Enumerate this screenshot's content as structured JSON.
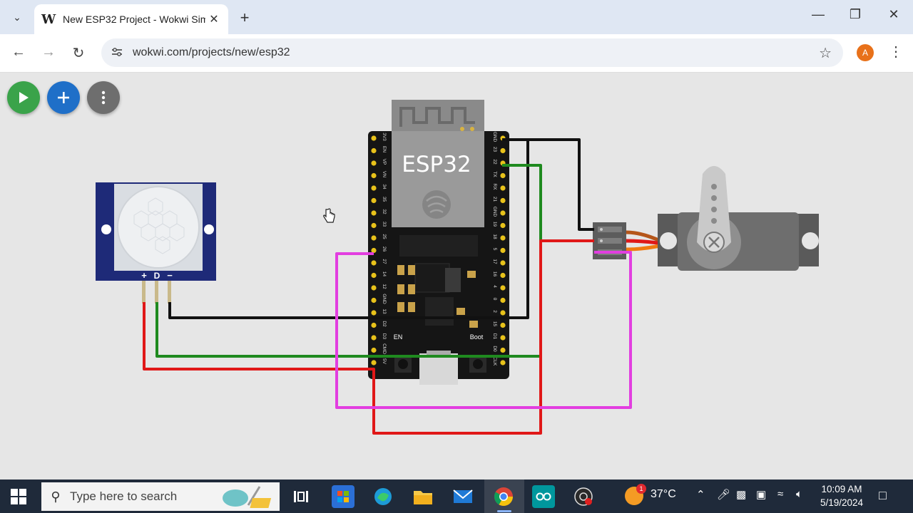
{
  "browser": {
    "tab": {
      "title": "New ESP32 Project - Wokwi Sim",
      "favicon": "W",
      "close": "✕"
    },
    "new_tab": "+",
    "window": {
      "minimize": "—",
      "restore": "❐",
      "close": "✕"
    },
    "nav": {
      "back": "←",
      "forward": "→",
      "reload": "↻"
    },
    "url": "wokwi.com/projects/new/esp32",
    "profile_initial": "A"
  },
  "canvas_toolbar": {
    "play_color": "#3aa34a",
    "add_color": "#1f6fc8",
    "more_color": "#6e6e6e"
  },
  "circuit": {
    "esp32": {
      "label": "ESP32",
      "left_pins": [
        "3V3",
        "EN",
        "VP",
        "VN",
        "34",
        "35",
        "32",
        "33",
        "25",
        "26",
        "27",
        "14",
        "12",
        "GND",
        "13",
        "D2",
        "D3",
        "CMD",
        "5V"
      ],
      "right_pins": [
        "GND",
        "23",
        "22",
        "TX",
        "RX",
        "21",
        "GND",
        "19",
        "18",
        "5",
        "17",
        "16",
        "4",
        "0",
        "2",
        "15",
        "D1",
        "D0",
        "CLK"
      ],
      "button_en": "EN",
      "button_boot": "Boot"
    },
    "pir_sensor": {
      "pin_labels": [
        "+",
        "D",
        "−"
      ]
    },
    "wire_colors": {
      "black": "#111111",
      "green": "#1f8a1f",
      "red": "#e01818",
      "magenta": "#e23ee0",
      "orange": "#f07a10"
    }
  },
  "taskbar": {
    "search_placeholder": "Type here to search",
    "weather": "37°C",
    "weather_badge": "1",
    "time": "10:09 AM",
    "date": "5/19/2024"
  }
}
